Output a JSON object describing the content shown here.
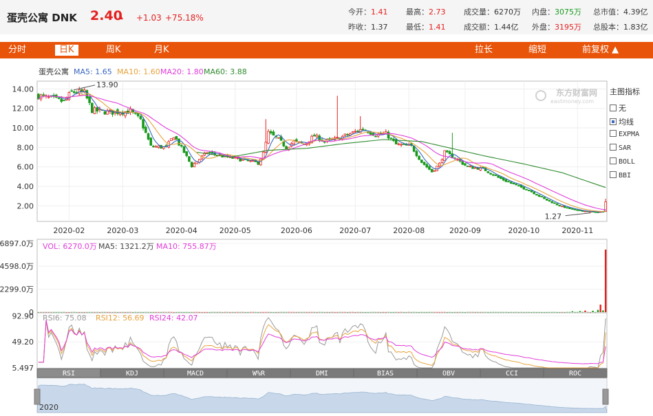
{
  "quote": {
    "name": "蛋壳公寓",
    "code": "DNK",
    "price": "2.40",
    "arrow": "▲",
    "change": "+1.03",
    "change_pct": "+75.18%",
    "open_label": "今开：",
    "open": "1.41",
    "high_label": "最高：",
    "high": "2.73",
    "volume_label": "成交量：",
    "volume": "6270万",
    "inner_label": "内盘：",
    "inner": "3075万",
    "mktcap_label": "总市值：",
    "mktcap": "4.39亿",
    "prevclose_label": "昨收：",
    "prevclose": "1.37",
    "low_label": "最低：",
    "low": "1.41",
    "amount_label": "成交额：",
    "amount": "1.44亿",
    "outer_label": "外盘：",
    "outer": "3195万",
    "shares_label": "总股本：",
    "shares": "1.83亿"
  },
  "tabs": {
    "fenshi": "分时",
    "rik": "日K",
    "zhouk": "周K",
    "yuek": "月K",
    "lachang": "拉长",
    "suoduan": "缩短",
    "fuquan": "前复权 ▲"
  },
  "side": {
    "title": "主图指标",
    "options": [
      "无",
      "均线",
      "EXPMA",
      "SAR",
      "BOLL",
      "BBI"
    ],
    "selected": "均线"
  },
  "indicator_tabs": [
    "RSI",
    "KDJ",
    "MACD",
    "W%R",
    "DMI",
    "BIAS",
    "OBV",
    "CCI",
    "ROC"
  ],
  "nav": {
    "year": "2020"
  },
  "watermark": "东方财富网",
  "watermark_sub": "eastmoney.com",
  "colors": {
    "up": "#e4201f",
    "down": "#189a1b",
    "accent": "#e8540a",
    "ma5": "#3a66c0",
    "ma10": "#e6a23c",
    "ma20": "#e03cd9",
    "ma60": "#2f8a2f"
  },
  "chart_data": [
    {
      "type": "candlestick",
      "title": "蛋壳公寓",
      "legend": [
        {
          "name": "MA5",
          "value": "1.65",
          "color": "#3a66c0"
        },
        {
          "name": "MA10",
          "value": "1.60",
          "color": "#e6a23c"
        },
        {
          "name": "MA20",
          "value": "1.80",
          "color": "#e03cd9"
        },
        {
          "name": "MA60",
          "value": "3.88",
          "color": "#2f8a2f"
        }
      ],
      "yticks": [
        "14.00",
        "12.00",
        "10.00",
        "8.00",
        "6.00",
        "4.00",
        "2.00"
      ],
      "ytick_values": [
        14,
        12,
        10,
        8,
        6,
        4,
        2
      ],
      "ylim": [
        0.4,
        14.8
      ],
      "xticks": [
        "2020-02",
        "2020-03",
        "2020-04",
        "2020-05",
        "2020-06",
        "2020-07",
        "2020-08",
        "2020-09",
        "2020-10",
        "2020-11"
      ],
      "xtick_idx": [
        12,
        33,
        56,
        77,
        101,
        124,
        145,
        167,
        190,
        211
      ],
      "annotations": [
        {
          "text": "13.90",
          "idx": 13,
          "value": 13.9
        },
        {
          "text": "1.27",
          "idx": 217,
          "value": 1.27
        }
      ],
      "anchors": [
        [
          0,
          13.3
        ],
        [
          10,
          12.7
        ],
        [
          13,
          13.7
        ],
        [
          18,
          13.6
        ],
        [
          21,
          11.8
        ],
        [
          28,
          11.6
        ],
        [
          36,
          11.7
        ],
        [
          40,
          10.8
        ],
        [
          44,
          8.1
        ],
        [
          50,
          8.0
        ],
        [
          53,
          9.2
        ],
        [
          57,
          7.5
        ],
        [
          60,
          6.1
        ],
        [
          66,
          7.5
        ],
        [
          72,
          7.1
        ],
        [
          80,
          6.7
        ],
        [
          86,
          6.4
        ],
        [
          88,
          7.4
        ],
        [
          90,
          9.5
        ],
        [
          94,
          8.8
        ],
        [
          97,
          8.0
        ],
        [
          100,
          8.6
        ],
        [
          104,
          8.3
        ],
        [
          108,
          9.2
        ],
        [
          112,
          8.6
        ],
        [
          117,
          8.9
        ],
        [
          121,
          9.3
        ],
        [
          127,
          9.9
        ],
        [
          132,
          9.3
        ],
        [
          136,
          9.4
        ],
        [
          140,
          8.3
        ],
        [
          146,
          8.1
        ],
        [
          150,
          6.5
        ],
        [
          154,
          5.5
        ],
        [
          157,
          6.3
        ],
        [
          159,
          7.5
        ],
        [
          163,
          6.9
        ],
        [
          168,
          6.0
        ],
        [
          174,
          5.8
        ],
        [
          180,
          4.9
        ],
        [
          186,
          4.2
        ],
        [
          192,
          3.6
        ],
        [
          198,
          2.7
        ],
        [
          204,
          2.0
        ],
        [
          210,
          1.55
        ],
        [
          214,
          1.45
        ],
        [
          218,
          1.35
        ],
        [
          221,
          1.4
        ]
      ],
      "spikes": [
        {
          "idx": 89,
          "value": 10.9
        },
        {
          "idx": 117,
          "value": 13.3
        },
        {
          "idx": 126,
          "value": 11.2
        },
        {
          "idx": 162,
          "value": 9.5
        },
        {
          "idx": 222,
          "value": 2.73
        }
      ],
      "last_close": 2.4,
      "last_open": 1.41,
      "ma60_path": [
        [
          62,
          7.5
        ],
        [
          75,
          7.0
        ],
        [
          90,
          7.7
        ],
        [
          105,
          7.9
        ],
        [
          120,
          8.4
        ],
        [
          135,
          8.8
        ],
        [
          150,
          8.6
        ],
        [
          160,
          8.0
        ],
        [
          175,
          7.1
        ],
        [
          190,
          6.3
        ],
        [
          205,
          5.4
        ],
        [
          215,
          4.5
        ],
        [
          222,
          3.88
        ]
      ]
    },
    {
      "type": "bar",
      "legend": [
        {
          "name": "VOL",
          "value": "6270.0万"
        },
        {
          "name": "MA5",
          "value": "1321.2万"
        },
        {
          "name": "MA10",
          "value": "755.87万"
        }
      ],
      "yticks": [
        "6897.0万",
        "4598.0万",
        "2299.0万",
        "0"
      ],
      "ytick_values": [
        6897,
        4598,
        2299,
        0
      ],
      "ylim": [
        0,
        7300
      ],
      "unit": "万",
      "recent": [
        {
          "idx": 209,
          "value": 90
        },
        {
          "idx": 212,
          "value": 110
        },
        {
          "idx": 214,
          "value": 160
        },
        {
          "idx": 217,
          "value": 140
        },
        {
          "idx": 219,
          "value": 230
        },
        {
          "idx": 220,
          "value": 760
        },
        {
          "idx": 221,
          "value": 180
        },
        {
          "idx": 222,
          "value": 6270
        }
      ]
    },
    {
      "type": "line",
      "legend": [
        {
          "name": "RSI6",
          "value": "75.08"
        },
        {
          "name": "RSI12",
          "value": "56.69"
        },
        {
          "name": "RSI24",
          "value": "42.07"
        }
      ],
      "yticks": [
        "92.90",
        "49.20",
        "5.497"
      ],
      "ytick_values": [
        92.9,
        49.2,
        5.497
      ],
      "ylim": [
        5.497,
        98
      ]
    }
  ]
}
